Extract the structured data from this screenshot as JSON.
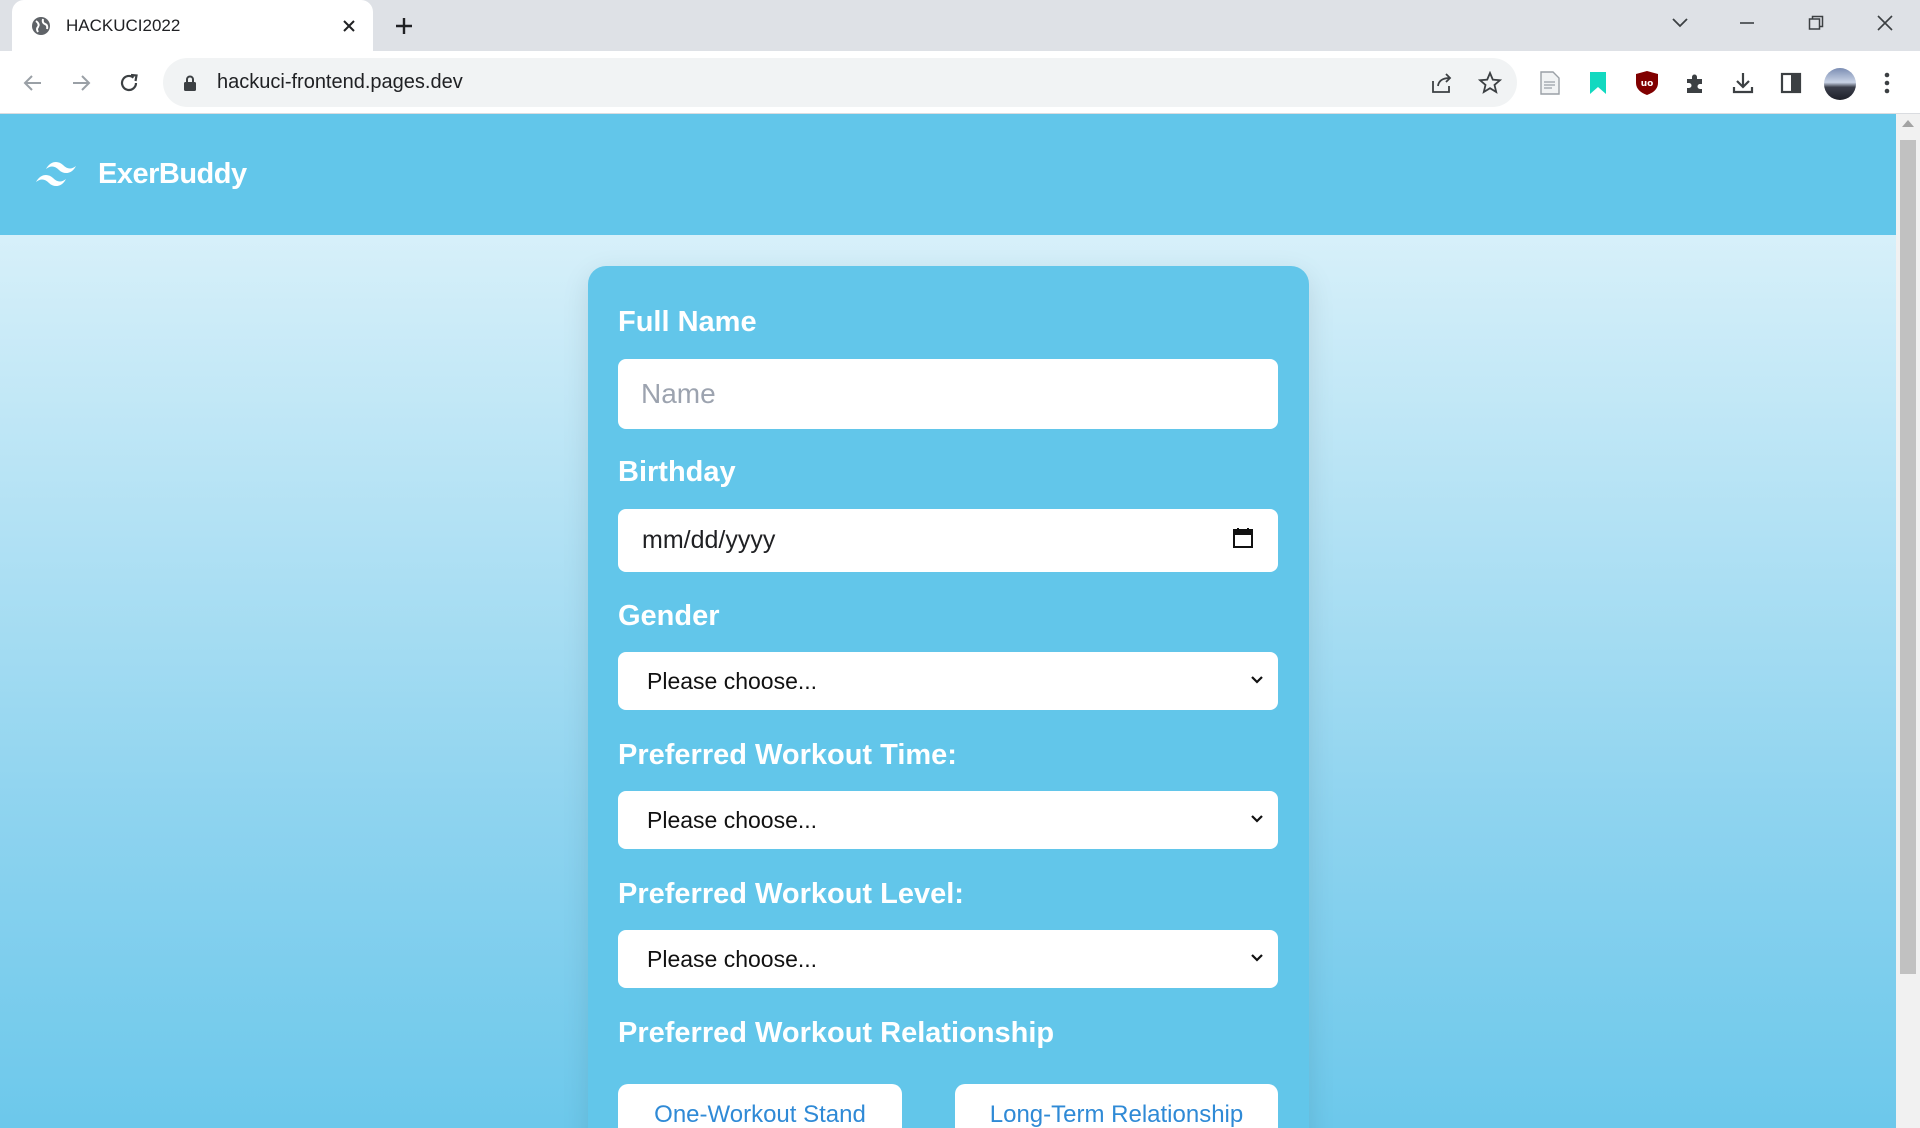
{
  "browser": {
    "tab_title": "HACKUCI2022",
    "url": "hackuci-frontend.pages.dev"
  },
  "site": {
    "brand": "ExerBuddy"
  },
  "form": {
    "full_name": {
      "label": "Full Name",
      "placeholder": "Name"
    },
    "birthday": {
      "label": "Birthday",
      "value": "mm/dd/yyyy"
    },
    "gender": {
      "label": "Gender",
      "selected": "Please choose..."
    },
    "workout_time": {
      "label": "Preferred Workout Time:",
      "selected": "Please choose..."
    },
    "workout_level": {
      "label": "Preferred Workout Level:",
      "selected": "Please choose..."
    },
    "relationship": {
      "label": "Preferred Workout Relationship",
      "options": [
        "One-Workout Stand",
        "Long-Term Relationship"
      ]
    }
  },
  "colors": {
    "header": "#62c6ea",
    "card": "#62c6ea",
    "link_text": "#2f8ad6"
  }
}
